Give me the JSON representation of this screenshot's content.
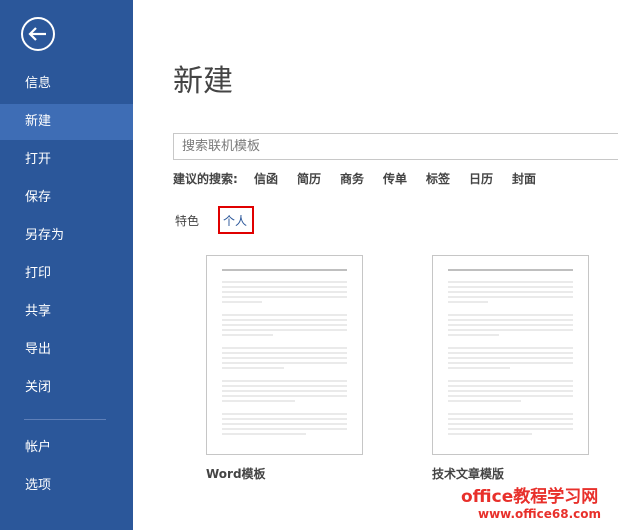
{
  "sidebar": {
    "items": [
      {
        "label": "信息",
        "name": "sidebar-item-info"
      },
      {
        "label": "新建",
        "name": "sidebar-item-new",
        "active": true
      },
      {
        "label": "打开",
        "name": "sidebar-item-open"
      },
      {
        "label": "保存",
        "name": "sidebar-item-save"
      },
      {
        "label": "另存为",
        "name": "sidebar-item-save-as"
      },
      {
        "label": "打印",
        "name": "sidebar-item-print"
      },
      {
        "label": "共享",
        "name": "sidebar-item-share"
      },
      {
        "label": "导出",
        "name": "sidebar-item-export"
      },
      {
        "label": "关闭",
        "name": "sidebar-item-close"
      },
      {
        "label": "帐户",
        "name": "sidebar-item-account"
      },
      {
        "label": "选项",
        "name": "sidebar-item-options"
      }
    ]
  },
  "main": {
    "title": "新建",
    "search_placeholder": "搜索联机模板",
    "suggest_label": "建议的搜索:",
    "suggestions": [
      "信函",
      "简历",
      "商务",
      "传单",
      "标签",
      "日历",
      "封面"
    ],
    "tabs": [
      {
        "label": "特色",
        "selected": false
      },
      {
        "label": "个人",
        "selected": true
      }
    ],
    "templates": [
      {
        "label": "Word模板"
      },
      {
        "label": "技术文章模版"
      }
    ]
  },
  "watermark": {
    "line1": "office教程学习网",
    "line2": "www.office68.com"
  },
  "colors": {
    "sidebar_bg": "#2b579a",
    "sidebar_active": "#3e6db5",
    "tab_selected": "#2b579a",
    "highlight_box": "#e00000",
    "watermark": "#e8302b"
  }
}
